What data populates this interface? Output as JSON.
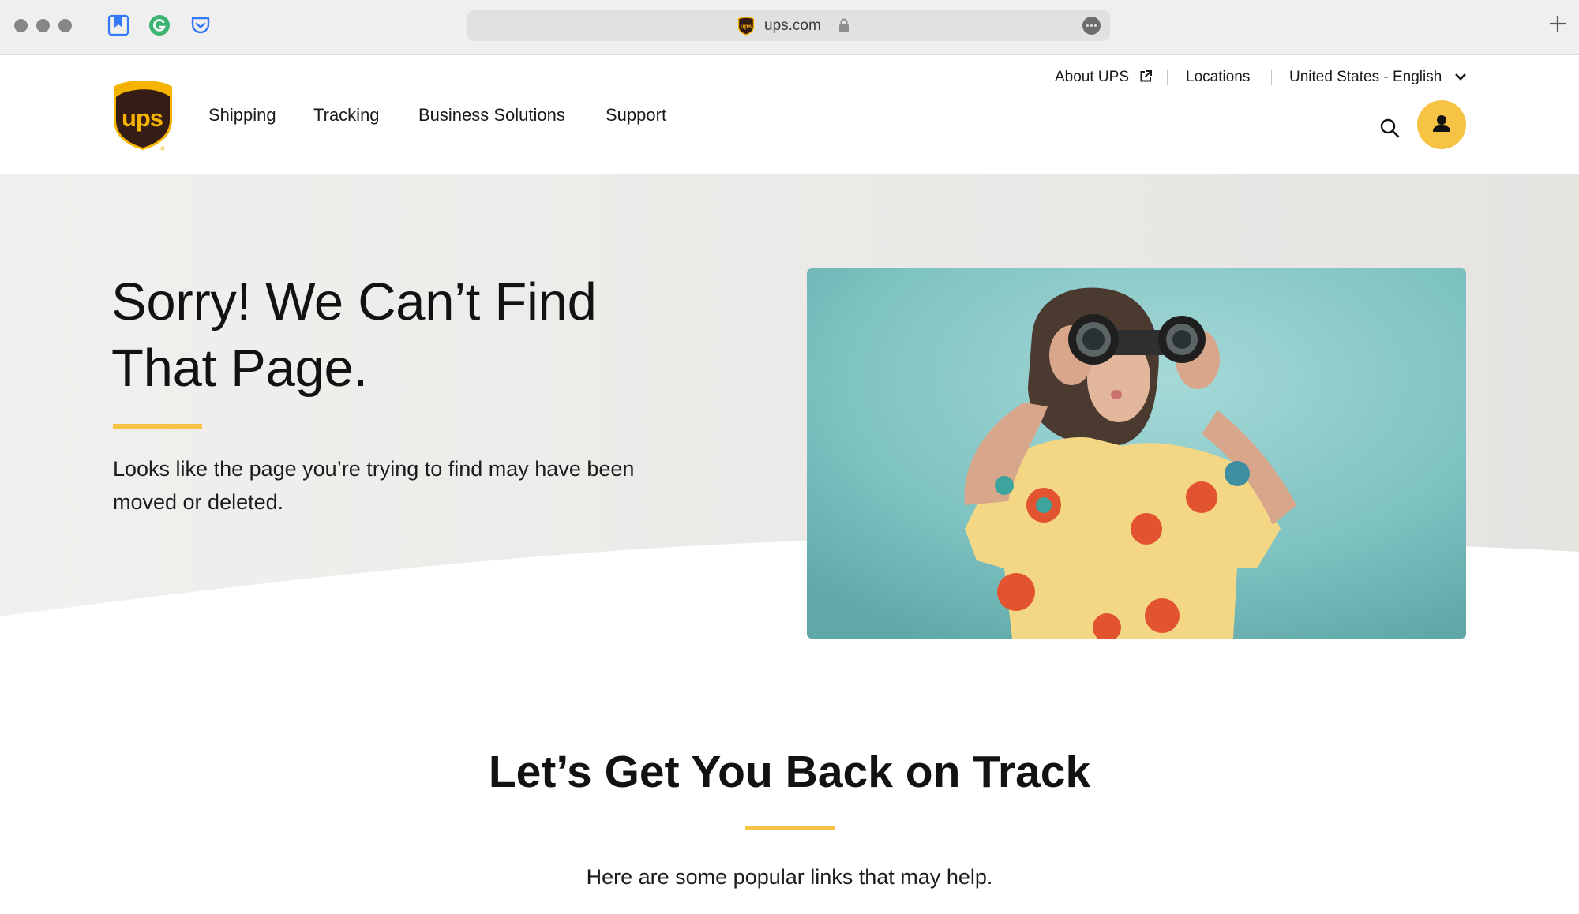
{
  "browser": {
    "url": "ups.com",
    "extensions": [
      {
        "name": "bookmark-extension-icon",
        "color": "#3478f6"
      },
      {
        "name": "grammarly-extension-icon",
        "color": "#3cb371"
      },
      {
        "name": "pocket-extension-icon",
        "color": "#3478f6"
      }
    ],
    "new_tab_label": "+"
  },
  "header": {
    "brand": "UPS",
    "nav": [
      {
        "label": "Shipping"
      },
      {
        "label": "Tracking"
      },
      {
        "label": "Business Solutions"
      },
      {
        "label": "Support"
      }
    ],
    "utility": {
      "about": "About UPS",
      "locations": "Locations",
      "locale": "United States - English"
    },
    "search_icon": "search-icon",
    "account_icon": "user-icon"
  },
  "hero": {
    "title_line1": "Sorry! We Can’t Find",
    "title_line2": "That Page.",
    "description_line1": "Looks like the page you’re trying to find may have been",
    "description_line2": "moved or deleted.",
    "image_alt": "Woman in a yellow floral shirt looking through binoculars against a teal background"
  },
  "help_section": {
    "title": "Let’s Get You Back on Track",
    "subtitle": "Here are some popular links that may help."
  },
  "colors": {
    "brand_yellow": "#f6c344",
    "brand_brown": "#351c15",
    "hero_gray": "#f0efed",
    "photo_teal": "#7dbfbf"
  }
}
